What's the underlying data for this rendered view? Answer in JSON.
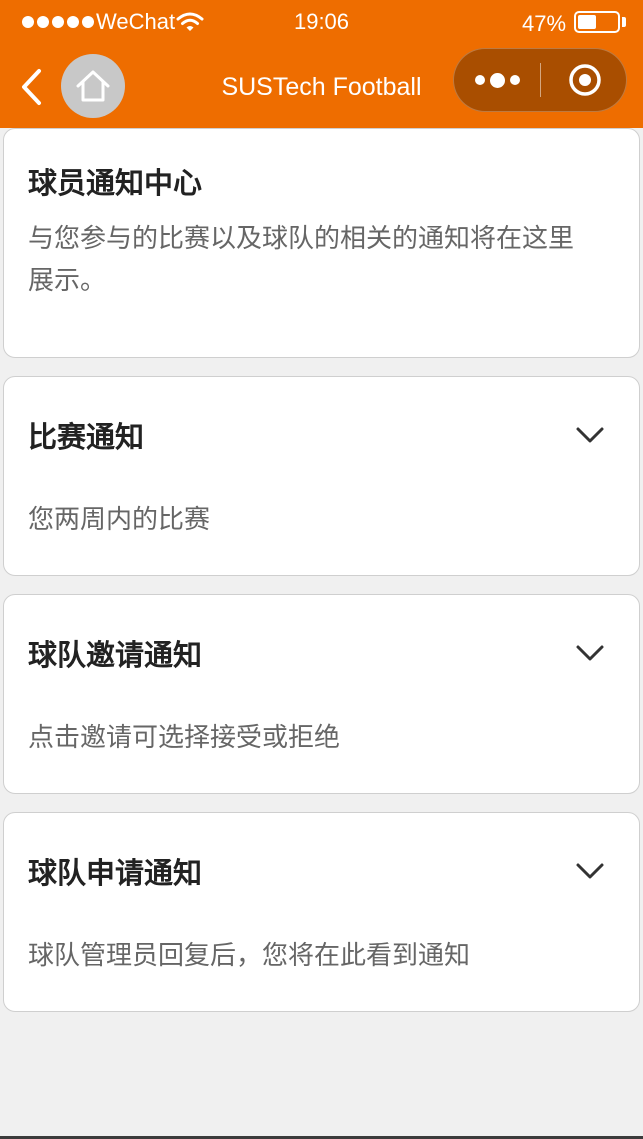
{
  "status_bar": {
    "carrier": "WeChat",
    "time": "19:06",
    "battery": "47%",
    "battery_level": 0.47
  },
  "nav": {
    "title": "SUSTech Football",
    "back_icon": "chevron-left-icon",
    "home_icon": "home-icon",
    "more_icon": "more-dots-icon",
    "close_icon": "target-close-icon"
  },
  "colors": {
    "accent": "#ee6d00",
    "capsule": "#a94e00",
    "background": "#f0f0f0"
  },
  "cards": [
    {
      "title": "球员通知中心",
      "desc_lines": [
        "与您参与的比赛以及球队的相关的通知将在这里",
        "展示。"
      ],
      "expandable": false
    },
    {
      "title": "比赛通知",
      "desc": "您两周内的比赛",
      "expandable": true
    },
    {
      "title": "球队邀请通知",
      "desc": "点击邀请可选择接受或拒绝",
      "expandable": true
    },
    {
      "title": "球队申请通知",
      "desc": "球队管理员回复后，您将在此看到通知",
      "expandable": true
    }
  ]
}
